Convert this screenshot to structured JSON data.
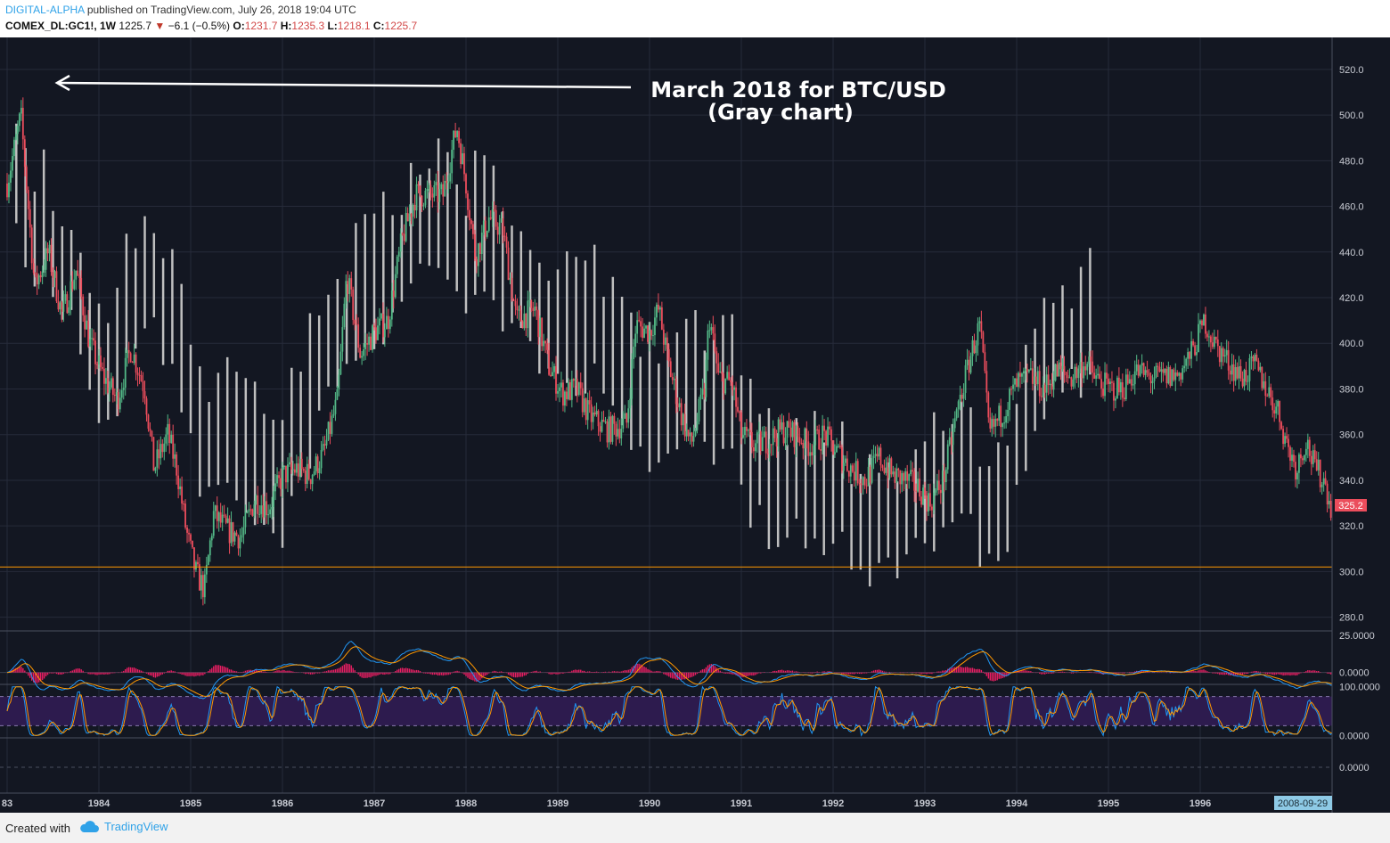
{
  "header": {
    "author": "DIGITAL-ALPHA",
    "published": "published on TradingView.com, July 26, 2018 19:04 UTC",
    "symbol": "COMEX_DL:GC1!, 1W",
    "last": "1225.7",
    "down_arrow": "▼",
    "change": "−6.1 (−0.5%)",
    "open_label": "O:",
    "open": "1231.7",
    "high_label": "H:",
    "high": "1235.3",
    "low_label": "L:",
    "low": "1218.1",
    "close_label": "C:",
    "close": "1225.7"
  },
  "footer": {
    "created": "Created with",
    "brand": "TradingView"
  },
  "colors": {
    "background": "#131722",
    "grid": "#262b3a",
    "up": "#53b987",
    "down": "#eb4d5c",
    "gray_bars": "#bfbfbf",
    "support_line": "#ff9800",
    "macd": "#2196f3",
    "signal": "#ff9800",
    "hist": "#e91e63",
    "stoch_band": "#2d1b4e",
    "price_badge": "#eb4d5c",
    "date_badge": "#8ecae6"
  },
  "annotation": {
    "line1": "March 2018 for BTC/USD",
    "line2": "(Gray chart)"
  },
  "chart_data": {
    "type": "candlestick",
    "timeframe": "1W",
    "y_ticks": [
      "520.0",
      "500.0",
      "480.0",
      "460.0",
      "440.0",
      "420.0",
      "400.0",
      "380.0",
      "360.0",
      "340.0",
      "320.0",
      "300.0",
      "280.0"
    ],
    "ylim": [
      274,
      534
    ],
    "x_ticks": [
      "83",
      "1984",
      "1985",
      "1986",
      "1987",
      "1988",
      "1989",
      "1990",
      "1991",
      "1992",
      "1993",
      "1994",
      "1995",
      "1996"
    ],
    "last_price": "325.2",
    "support_level": 302,
    "crosshair_date": "2008-09-29",
    "series": [
      {
        "name": "gold",
        "kind": "candles",
        "points": [
          [
            1983.0,
            470
          ],
          [
            1983.15,
            500
          ],
          [
            1983.3,
            425
          ],
          [
            1983.45,
            440
          ],
          [
            1983.6,
            412
          ],
          [
            1983.75,
            432
          ],
          [
            1983.9,
            400
          ],
          [
            1984.05,
            385
          ],
          [
            1984.2,
            375
          ],
          [
            1984.35,
            398
          ],
          [
            1984.5,
            380
          ],
          [
            1984.6,
            345
          ],
          [
            1984.75,
            360
          ],
          [
            1984.85,
            345
          ],
          [
            1984.95,
            318
          ],
          [
            1985.05,
            300
          ],
          [
            1985.15,
            292
          ],
          [
            1985.25,
            325
          ],
          [
            1985.4,
            318
          ],
          [
            1985.55,
            315
          ],
          [
            1985.7,
            332
          ],
          [
            1985.85,
            328
          ],
          [
            1986.0,
            342
          ],
          [
            1986.15,
            345
          ],
          [
            1986.3,
            342
          ],
          [
            1986.45,
            352
          ],
          [
            1986.6,
            375
          ],
          [
            1986.7,
            430
          ],
          [
            1986.85,
            395
          ],
          [
            1987.0,
            405
          ],
          [
            1987.15,
            410
          ],
          [
            1987.3,
            445
          ],
          [
            1987.45,
            465
          ],
          [
            1987.6,
            465
          ],
          [
            1987.75,
            465
          ],
          [
            1987.9,
            495
          ],
          [
            1988.0,
            470
          ],
          [
            1988.1,
            438
          ],
          [
            1988.25,
            455
          ],
          [
            1988.4,
            450
          ],
          [
            1988.55,
            410
          ],
          [
            1988.75,
            415
          ],
          [
            1988.9,
            390
          ],
          [
            1989.05,
            378
          ],
          [
            1989.2,
            380
          ],
          [
            1989.35,
            368
          ],
          [
            1989.55,
            362
          ],
          [
            1989.75,
            365
          ],
          [
            1989.85,
            408
          ],
          [
            1990.0,
            405
          ],
          [
            1990.1,
            415
          ],
          [
            1990.2,
            392
          ],
          [
            1990.35,
            368
          ],
          [
            1990.45,
            355
          ],
          [
            1990.6,
            380
          ],
          [
            1990.65,
            412
          ],
          [
            1990.75,
            385
          ],
          [
            1990.9,
            382
          ],
          [
            1991.0,
            360
          ],
          [
            1991.15,
            355
          ],
          [
            1991.3,
            358
          ],
          [
            1991.45,
            362
          ],
          [
            1991.6,
            360
          ],
          [
            1991.75,
            355
          ],
          [
            1991.9,
            360
          ],
          [
            1992.05,
            352
          ],
          [
            1992.2,
            345
          ],
          [
            1992.35,
            340
          ],
          [
            1992.5,
            350
          ],
          [
            1992.65,
            342
          ],
          [
            1992.8,
            340
          ],
          [
            1992.95,
            336
          ],
          [
            1993.05,
            330
          ],
          [
            1993.2,
            340
          ],
          [
            1993.35,
            370
          ],
          [
            1993.5,
            395
          ],
          [
            1993.6,
            408
          ],
          [
            1993.7,
            360
          ],
          [
            1993.85,
            370
          ],
          [
            1994.0,
            382
          ],
          [
            1994.15,
            385
          ],
          [
            1994.3,
            380
          ],
          [
            1994.45,
            388
          ],
          [
            1994.6,
            385
          ],
          [
            1994.75,
            392
          ],
          [
            1994.85,
            385
          ],
          [
            1995.0,
            380
          ],
          [
            1995.15,
            380
          ],
          [
            1995.3,
            388
          ],
          [
            1995.45,
            385
          ],
          [
            1995.6,
            385
          ],
          [
            1995.75,
            386
          ],
          [
            1995.9,
            395
          ],
          [
            1996.05,
            410
          ],
          [
            1996.15,
            400
          ],
          [
            1996.3,
            392
          ],
          [
            1996.45,
            385
          ],
          [
            1996.6,
            390
          ],
          [
            1996.75,
            378
          ],
          [
            1996.85,
            370
          ],
          [
            1996.95,
            355
          ],
          [
            1997.05,
            345
          ],
          [
            1997.15,
            358
          ],
          [
            1997.25,
            345
          ],
          [
            1997.35,
            340
          ],
          [
            1997.45,
            325.2
          ]
        ]
      },
      {
        "name": "BTC/USD",
        "kind": "gray-bars",
        "points": [
          [
            1983.1,
            480
          ],
          [
            1983.25,
            440
          ],
          [
            1983.4,
            445
          ],
          [
            1983.55,
            438
          ],
          [
            1983.7,
            432
          ],
          [
            1983.85,
            410
          ],
          [
            1984.0,
            395
          ],
          [
            1984.15,
            385
          ],
          [
            1984.3,
            410
          ],
          [
            1984.45,
            425
          ],
          [
            1984.55,
            430
          ],
          [
            1984.7,
            418
          ],
          [
            1984.85,
            398
          ],
          [
            1984.95,
            390
          ],
          [
            1985.05,
            360
          ],
          [
            1985.15,
            350
          ],
          [
            1985.3,
            352
          ],
          [
            1985.45,
            360
          ],
          [
            1985.55,
            352
          ],
          [
            1985.7,
            345
          ],
          [
            1985.85,
            340
          ],
          [
            1986.0,
            340
          ],
          [
            1986.15,
            365
          ],
          [
            1986.3,
            375
          ],
          [
            1986.45,
            385
          ],
          [
            1986.6,
            410
          ],
          [
            1986.75,
            410
          ],
          [
            1986.85,
            420
          ],
          [
            1987.0,
            425
          ],
          [
            1987.15,
            430
          ],
          [
            1987.3,
            440
          ],
          [
            1987.45,
            448
          ],
          [
            1987.6,
            448
          ],
          [
            1987.75,
            452
          ],
          [
            1987.9,
            450
          ],
          [
            1988.0,
            440
          ],
          [
            1988.15,
            455
          ],
          [
            1988.3,
            445
          ],
          [
            1988.45,
            430
          ],
          [
            1988.55,
            420
          ],
          [
            1988.7,
            415
          ],
          [
            1988.85,
            408
          ],
          [
            1989.0,
            405
          ],
          [
            1989.15,
            402
          ],
          [
            1989.3,
            400
          ],
          [
            1989.45,
            405
          ],
          [
            1989.6,
            395
          ],
          [
            1989.75,
            382
          ],
          [
            1989.85,
            372
          ],
          [
            1990.0,
            372
          ],
          [
            1990.15,
            378
          ],
          [
            1990.3,
            380
          ],
          [
            1990.45,
            378
          ],
          [
            1990.6,
            378
          ],
          [
            1990.75,
            375
          ],
          [
            1990.9,
            375
          ],
          [
            1991.0,
            350
          ],
          [
            1991.15,
            342
          ],
          [
            1991.3,
            335
          ],
          [
            1991.45,
            338
          ],
          [
            1991.55,
            335
          ],
          [
            1991.7,
            338
          ],
          [
            1991.85,
            335
          ],
          [
            1992.0,
            335
          ],
          [
            1992.05,
            330
          ],
          [
            1992.15,
            325
          ],
          [
            1992.25,
            320
          ],
          [
            1992.35,
            318
          ],
          [
            1992.45,
            322
          ],
          [
            1992.6,
            318
          ],
          [
            1992.7,
            320
          ],
          [
            1992.85,
            325
          ],
          [
            1992.95,
            330
          ],
          [
            1993.1,
            330
          ],
          [
            1993.25,
            335
          ],
          [
            1993.4,
            340
          ],
          [
            1993.5,
            338
          ],
          [
            1993.6,
            330
          ],
          [
            1993.7,
            328
          ],
          [
            1993.85,
            325
          ],
          [
            1993.95,
            330
          ],
          [
            1994.05,
            370
          ],
          [
            1994.15,
            375
          ],
          [
            1994.3,
            388
          ],
          [
            1994.45,
            395
          ],
          [
            1994.6,
            400
          ],
          [
            1994.7,
            405
          ],
          [
            1994.8,
            408
          ]
        ]
      },
      {
        "name": "support",
        "kind": "horizontal-line",
        "value": 302
      }
    ],
    "indicators": [
      {
        "name": "MACD",
        "y_ticks": [
          "25.0000",
          "0.0000"
        ],
        "ylim": [
          -8,
          28
        ]
      },
      {
        "name": "Stochastic",
        "y_ticks": [
          "100.0000",
          "0.0000"
        ],
        "ylim": [
          -5,
          105
        ],
        "bands": [
          20,
          80
        ]
      },
      {
        "name": "blank",
        "y_ticks": [
          "0.0000"
        ]
      }
    ]
  }
}
